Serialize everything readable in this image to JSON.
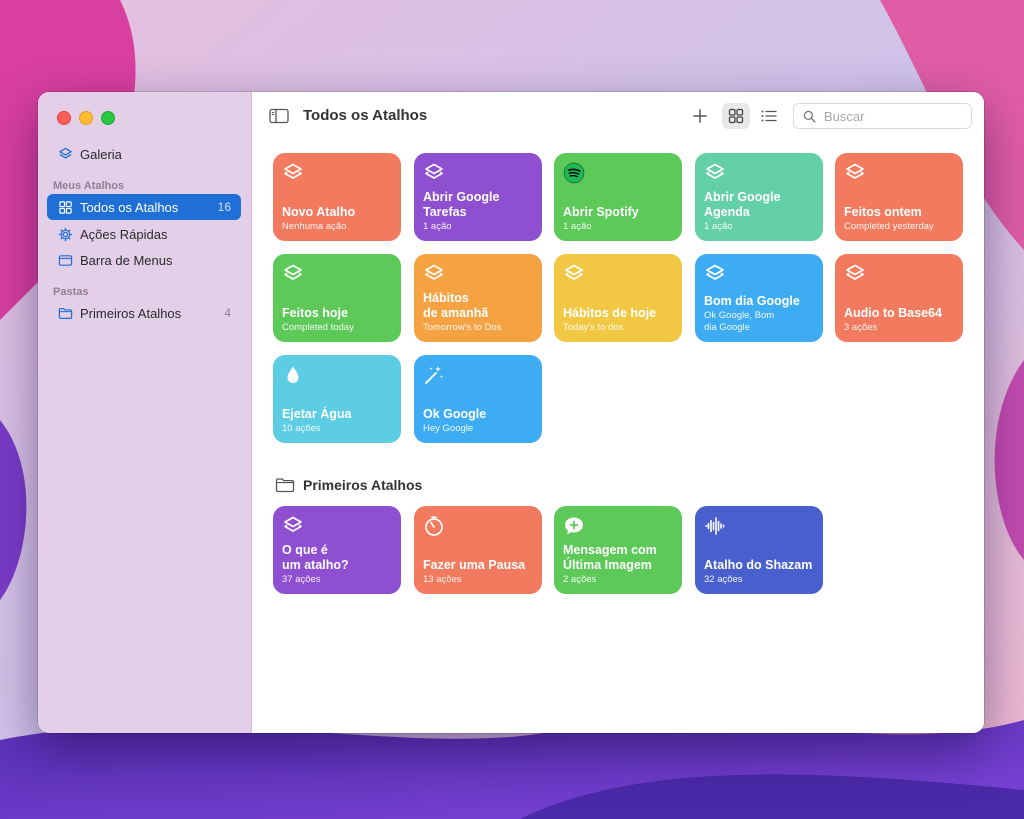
{
  "window": {
    "title": "Todos os Atalhos"
  },
  "colors": {
    "accent": "#1f6fd6",
    "sidebar_bg": "#e4cfe8"
  },
  "sidebar": {
    "gallery": {
      "label": "Galeria",
      "icon": "layers-icon"
    },
    "my_shortcuts_header": "Meus Atalhos",
    "items": [
      {
        "label": "Todos os Atalhos",
        "count": "16",
        "icon": "grid-icon",
        "active": true
      },
      {
        "label": "Ações Rápidas",
        "count": "",
        "icon": "gear-icon",
        "active": false
      },
      {
        "label": "Barra de Menus",
        "count": "",
        "icon": "menubar-icon",
        "active": false
      }
    ],
    "folders_header": "Pastas",
    "folders": [
      {
        "label": "Primeiros Atalhos",
        "count": "4",
        "icon": "folder-icon"
      }
    ]
  },
  "toolbar": {
    "add_icon": "plus-icon",
    "grid_view_icon": "grid-icon",
    "list_view_icon": "list-icon",
    "search_placeholder": "Buscar"
  },
  "shortcuts": [
    {
      "name": "Novo Atalho",
      "subtitle": "Nenhuma ação",
      "color": "#f27a5e",
      "icon": "layers-icon"
    },
    {
      "name": "Abrir Google\nTarefas",
      "subtitle": "1 ação",
      "color": "#8e4fd0",
      "icon": "layers-icon"
    },
    {
      "name": "Abrir Spotify",
      "subtitle": "1 ação",
      "color": "#5cc959",
      "icon": "spotify-icon"
    },
    {
      "name": "Abrir Google\nAgenda",
      "subtitle": "1 ação",
      "color": "#63d0a8",
      "icon": "layers-icon"
    },
    {
      "name": "Feitos ontem",
      "subtitle": "Completed yesterday",
      "color": "#f27a5e",
      "icon": "layers-icon"
    },
    {
      "name": "Feitos hoje",
      "subtitle": "Completed today",
      "color": "#5cc959",
      "icon": "layers-icon"
    },
    {
      "name": "Hábitos\nde amanhã",
      "subtitle": "Tomorrow's to Dos",
      "color": "#f5a243",
      "icon": "layers-icon"
    },
    {
      "name": "Hábitos de hoje",
      "subtitle": "Today's to dos",
      "color": "#f2c744",
      "icon": "layers-icon"
    },
    {
      "name": "Bom dia Google",
      "subtitle": "Ok Google, Bom\ndia Google",
      "color": "#3eacf2",
      "icon": "layers-icon"
    },
    {
      "name": "Audio to Base64",
      "subtitle": "3 ações",
      "color": "#f27a5e",
      "icon": "layers-icon"
    },
    {
      "name": "Ejetar Água",
      "subtitle": "10 ações",
      "color": "#5ccde3",
      "icon": "drop-icon"
    },
    {
      "name": "Ok Google",
      "subtitle": "Hey Google",
      "color": "#3eacf2",
      "icon": "magic-wand-icon"
    }
  ],
  "folder_section": {
    "title": "Primeiros Atalhos",
    "icon": "folder-icon",
    "shortcuts": [
      {
        "name": "O que é\num atalho?",
        "subtitle": "37 ações",
        "color": "#8e4fd0",
        "icon": "layers-icon"
      },
      {
        "name": "Fazer uma Pausa",
        "subtitle": "13 ações",
        "color": "#f27a5e",
        "icon": "timer-icon"
      },
      {
        "name": "Mensagem com\nÚltima Imagem",
        "subtitle": "2 ações",
        "color": "#5cc959",
        "icon": "message-plus-icon"
      },
      {
        "name": "Atalho do Shazam",
        "subtitle": "32 ações",
        "color": "#4a5fce",
        "icon": "waveform-icon"
      }
    ]
  }
}
